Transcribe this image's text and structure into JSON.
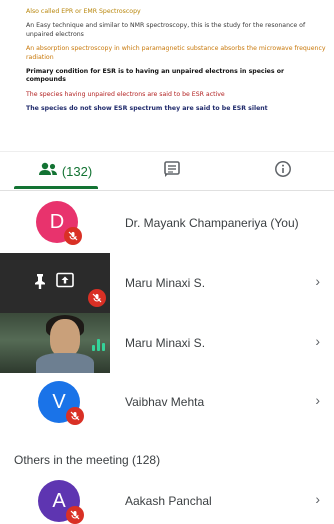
{
  "slide": {
    "line1": "Also called EPR or EMR Spectroscopy",
    "line2": "An Easy technique and similar to NMR spectroscopy, this is the study for the resonance of unpaired electrons",
    "line3": "An absorption spectroscopy in which paramagnetic substance absorbs the microwave frequency radiation",
    "line4": "Primary condition for ESR is to having an unpaired electrons in species or compounds",
    "line5": "The species having unpaired electrons are said to be ESR active",
    "line6": "The species do not show ESR spectrum they are said to be ESR silent"
  },
  "tabs": {
    "people_count": "(132)"
  },
  "participants": [
    {
      "initial": "D",
      "name": "Dr. Mayank Champaneriya (You)",
      "color": "#e8336d"
    },
    {
      "name": "Maru Minaxi S."
    },
    {
      "name": "Maru Minaxi S."
    },
    {
      "initial": "V",
      "name": "Vaibhav Mehta",
      "color": "#1a73e8"
    }
  ],
  "others": {
    "title": "Others in the meeting (128)",
    "items": [
      {
        "initial": "A",
        "name": "Aakash Panchal",
        "color": "#5e35b1"
      }
    ]
  },
  "chevron": "›"
}
